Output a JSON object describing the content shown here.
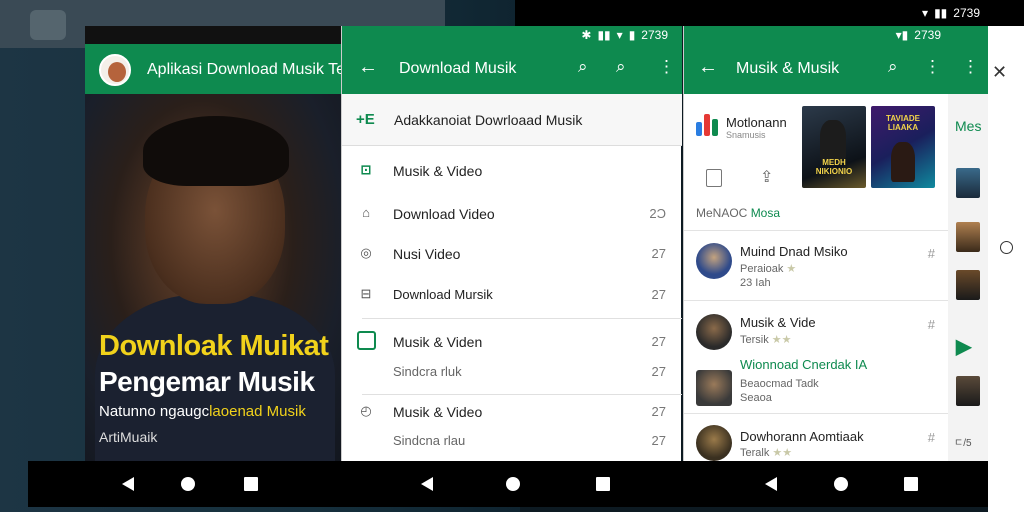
{
  "status": {
    "time": "2739"
  },
  "panel1": {
    "title": "Aplikasi Download Musik Terbaik",
    "headline_yellow": "Downloak Muikat",
    "headline_white": "Pengemar Musik",
    "subtitle_white": "Natunno ngaugc",
    "subtitle_yellow": "laoenad Musik",
    "caption": "ArtiMuaik"
  },
  "panel2": {
    "title": "Download Musik",
    "header_icon": "+E",
    "header_text": "Adakkanoiat Dowrloaad Musik",
    "items": [
      {
        "label": "Musik & Video",
        "count": "",
        "icon": "lock-icon"
      },
      {
        "label": "Download Video",
        "count": "2Ɔ",
        "icon": "folder-icon"
      },
      {
        "label": "Nusi Video",
        "count": "27",
        "icon": "pin-icon"
      },
      {
        "label": "Download Mursik",
        "count": "27",
        "icon": "number-icon"
      },
      {
        "label": "Musik & Viden",
        "count": "27",
        "icon": "check-icon"
      },
      {
        "label": "Sindcra rluk",
        "count": "27",
        "icon": ""
      },
      {
        "label": "Musik & Video",
        "count": "27",
        "icon": "clock-icon"
      },
      {
        "label": "Sindcna rlau",
        "count": "27",
        "icon": ""
      }
    ]
  },
  "panel3": {
    "title": "Musik & Musik",
    "brand_name": "Motlonann",
    "brand_sub": "Snamusis",
    "album1": "MEDH\nNIKIONIO",
    "album2": "TAVIADE\nLIAAKA",
    "section_label": "MeNAOC",
    "section_label_green": "Mosa",
    "rows": [
      {
        "name": "Muind Dnad Msiko",
        "meta1": "Peraioak",
        "meta2": "23 Iah",
        "count": "#"
      },
      {
        "name": "Musik & Vide",
        "meta1": "Tersik",
        "meta2": "",
        "count": "#"
      },
      {
        "name": "Wionnoad Cnerdak IA",
        "meta1": "Beaocmad Tadk",
        "meta2": "Seaoa",
        "count": ""
      },
      {
        "name": "Dowhorann Aomtiaak",
        "meta1": "Teralk",
        "meta2": "",
        "count": "#"
      }
    ]
  },
  "panel4": {
    "label": "Mes",
    "rating": "ㄷ/5"
  }
}
